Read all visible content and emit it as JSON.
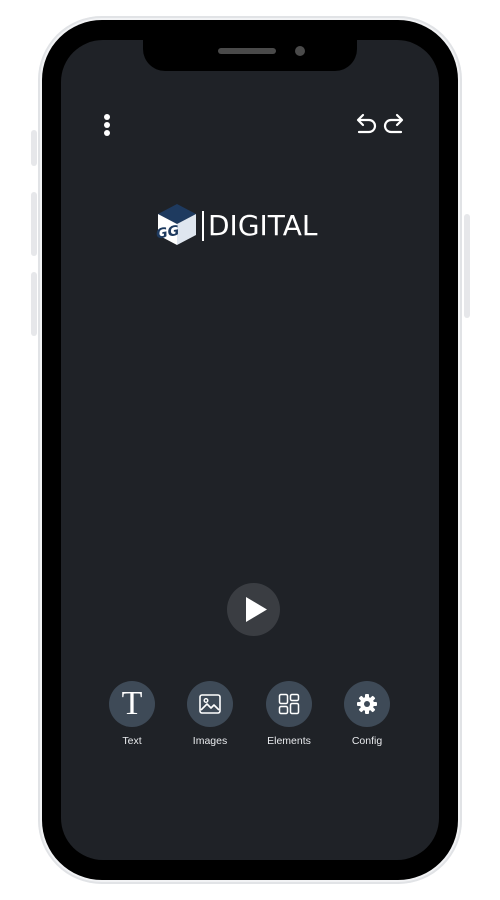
{
  "logo": {
    "monogram": "GG",
    "wordmark": "DIGITAL",
    "cube_colors": {
      "top": "#1e3a5f",
      "left": "#ffffff",
      "right": "#dfe6ef"
    }
  },
  "top_bar": {
    "menu_icon": "more-vertical-icon",
    "undo_icon": "undo-icon",
    "redo_icon": "redo-icon"
  },
  "play": {
    "icon": "play-icon"
  },
  "toolbar": {
    "items": [
      {
        "label": "Text",
        "icon": "text-icon"
      },
      {
        "label": "Images",
        "icon": "image-icon"
      },
      {
        "label": "Elements",
        "icon": "elements-icon"
      },
      {
        "label": "Config",
        "icon": "gear-icon"
      }
    ]
  },
  "colors": {
    "screen_background": "#1f2227",
    "tool_button": "#3e4a57",
    "play_button": "#3a3d42",
    "foreground": "#ffffff"
  }
}
